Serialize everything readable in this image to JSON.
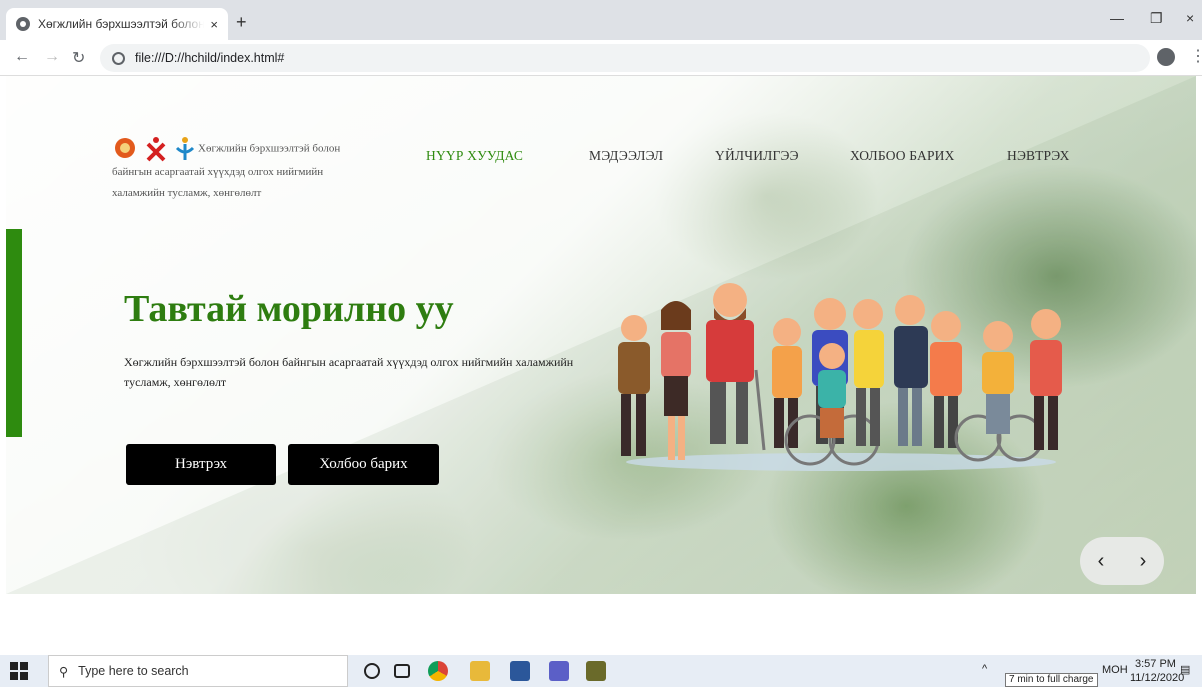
{
  "browser": {
    "tab_title": "Хөгжлийн бэрхшээлтэй болон б",
    "tab_close": "×",
    "new_tab": "+",
    "url": "file:///D://hchild/index.html#",
    "win_min": "—",
    "win_restore": "❐",
    "win_close": "×"
  },
  "site": {
    "logo_text": "Хөгжлийн бэрхшээлтэй болон байнгын асаргаатай хүүхдэд олгох нийгмийн халамжийн тусламж, хөнгөлөлт",
    "nav": [
      "НҮҮР ХУУДАС",
      "МЭДЭЭЛЭЛ",
      "ҮЙЛЧИЛГЭЭ",
      "ХОЛБОО БАРИХ",
      "НЭВТРЭХ"
    ],
    "hero_title": "Тавтай морилно уу",
    "hero_subtitle": "Хөгжлийн бэрхшээлтэй болон байнгын асаргаатай хүүхдэд олгох нийгмийн халамжийн тусламж, хөнгөлөлт",
    "btn_login": "Нэвтрэх",
    "btn_contact": "Холбоо барих",
    "prev": "‹",
    "next": "›",
    "accent": "#2e8b0f"
  },
  "taskbar": {
    "search_placeholder": "Type here to search",
    "time": "3:57 PM",
    "date": "11/12/2020",
    "lang": "МОН",
    "battery_tip": "7 min to full charge"
  }
}
